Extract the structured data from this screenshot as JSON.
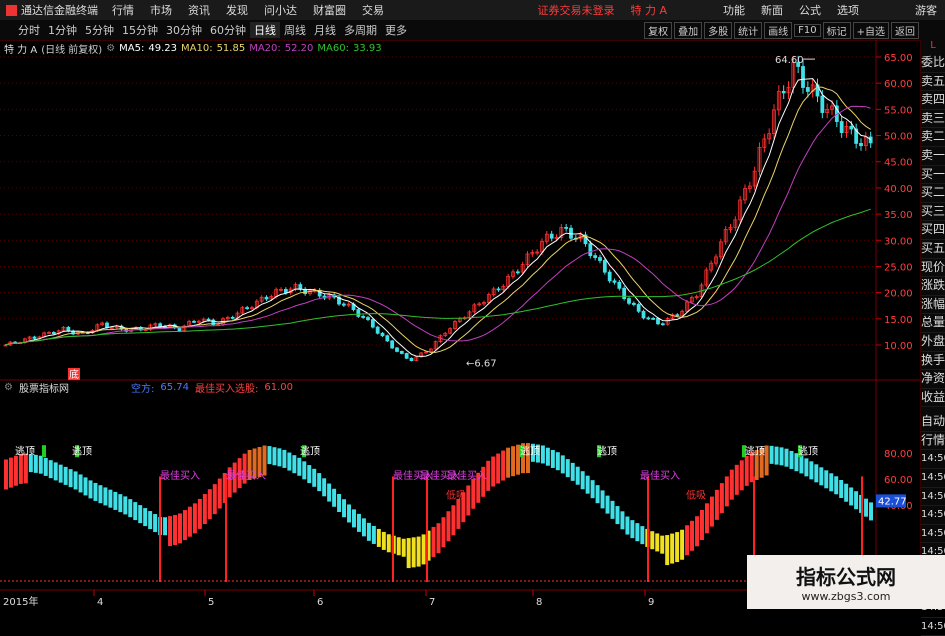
{
  "menubar": {
    "app_title": "通达信金融终端",
    "items": [
      "行情",
      "市场",
      "资讯",
      "发现",
      "问小达",
      "财富圈",
      "交易"
    ],
    "status": "证券交易未登录",
    "stock_name": "特 力 A",
    "right_items": [
      "功能",
      "新面",
      "公式",
      "选项"
    ],
    "guest": "游客"
  },
  "toolbar": {
    "periods": [
      "分时",
      "1分钟",
      "5分钟",
      "15分钟",
      "30分钟",
      "60分钟",
      "日线",
      "周线",
      "月线",
      "多周期",
      "更多"
    ],
    "selected": "日线",
    "right_buttons": [
      "复权",
      "叠加",
      "多股",
      "统计",
      "画线",
      "F10",
      "标记",
      "+自选",
      "返回"
    ]
  },
  "main_chart": {
    "title": "特 力 A",
    "adjust": "(日线 前复权)",
    "ma": [
      {
        "label": "MA5:",
        "value": "49.23",
        "color": "#ffffff"
      },
      {
        "label": "MA10:",
        "value": "51.85",
        "color": "#e8d46a"
      },
      {
        "label": "MA20:",
        "value": "52.20",
        "color": "#c040c0"
      },
      {
        "label": "MA60:",
        "value": "33.93",
        "color": "#30c030"
      }
    ],
    "yticks": [
      "65.00",
      "60.00",
      "55.00",
      "50.00",
      "45.00",
      "40.00",
      "35.00",
      "30.00",
      "25.00",
      "20.00",
      "15.00",
      "10.00"
    ],
    "high_label": "64.60",
    "low_label": "6.67",
    "corner_mark": "底"
  },
  "indicator": {
    "name": "股票指标网",
    "f1_label": "空方:",
    "f1_value": "65.74",
    "f2_label": "最佳买入选股:",
    "f2_value": "61.00",
    "yticks": [
      "80.00",
      "60.00",
      "40.00"
    ],
    "current": "42.77",
    "texts": {
      "escape": "逃顶",
      "buy": "最佳买入",
      "low": "低吸"
    }
  },
  "time_axis": {
    "year": "2015年",
    "months": [
      "4",
      "5",
      "6",
      "7",
      "8",
      "9",
      "1"
    ]
  },
  "sidebar": {
    "top": "L",
    "items": [
      "委比",
      "卖五",
      "卖四",
      "卖三",
      "卖二",
      "卖一",
      "买一",
      "买二",
      "买三",
      "买四",
      "买五",
      "现价",
      "涨跌",
      "涨幅",
      "总量",
      "外盘",
      "换手",
      "净资",
      "收益"
    ],
    "bottom": [
      "自动",
      "行情"
    ],
    "times": [
      "14:50",
      "14:50",
      "14:50",
      "14:50",
      "14:50",
      "14:50",
      "14:50",
      "14:50",
      "14:50",
      "14:50"
    ]
  },
  "watermark": {
    "title": "指标公式网",
    "url": "www.zbgs3.com"
  },
  "colors": {
    "up": "#ff3030",
    "down": "#40e0e8",
    "ma5": "#ffffff",
    "ma10": "#e8d46a",
    "ma20": "#c040c0",
    "ma60": "#30c030"
  },
  "chart_data": {
    "type": "candlestick",
    "x": "2015 daily",
    "ylim": [
      5,
      67
    ],
    "series": [
      {
        "name": "MA5",
        "values": []
      },
      {
        "name": "MA10",
        "values": []
      },
      {
        "name": "MA20",
        "values": []
      },
      {
        "name": "MA60",
        "values": []
      }
    ],
    "close_path": [
      10,
      11,
      12,
      13,
      12,
      14,
      13,
      13,
      14,
      13,
      15,
      14,
      16,
      18,
      20,
      21,
      20,
      19,
      17,
      14,
      10,
      7,
      9,
      13,
      16,
      19,
      22,
      26,
      30,
      32,
      30,
      25,
      20,
      16,
      14,
      16,
      20,
      28,
      35,
      44,
      55,
      63,
      58,
      54,
      50,
      48
    ],
    "osc_path": [
      75,
      80,
      78,
      72,
      66,
      58,
      52,
      46,
      38,
      30,
      33,
      42,
      55,
      70,
      82,
      86,
      83,
      76,
      66,
      52,
      38,
      26,
      18,
      14,
      16,
      26,
      42,
      60,
      76,
      84,
      88,
      86,
      80,
      70,
      58,
      44,
      30,
      22,
      16,
      20,
      32,
      50,
      68,
      80,
      86,
      84,
      78,
      70,
      62,
      52,
      42
    ]
  }
}
